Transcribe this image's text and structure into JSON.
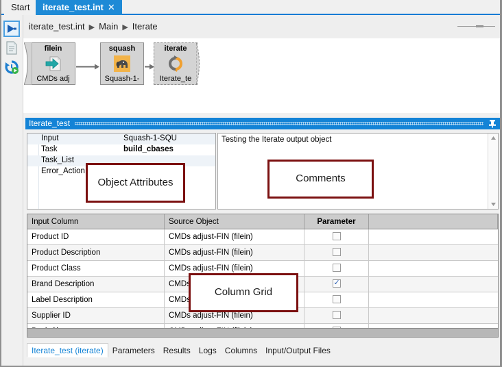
{
  "window": {
    "tabs": [
      {
        "label": "Start",
        "active": false,
        "closable": false
      },
      {
        "label": "iterate_test.int",
        "active": true,
        "closable": true,
        "close_glyph": "✕"
      }
    ]
  },
  "rail": {
    "icons": [
      {
        "name": "run-icon",
        "selected": true
      },
      {
        "name": "document-icon",
        "selected": false
      },
      {
        "name": "history-icon",
        "selected": false
      }
    ]
  },
  "breadcrumb": {
    "items": [
      "iterate_test.int",
      "Main",
      "Iterate"
    ],
    "separator": "▶"
  },
  "flow": {
    "nodes": [
      {
        "title": "filein",
        "subtitle": "CMDs adj",
        "icon": "file-in-icon"
      },
      {
        "title": "squash",
        "subtitle": "Squash-1-",
        "icon": "elephant-icon"
      },
      {
        "title": "iterate",
        "subtitle": "Iterate_te",
        "icon": "iterate-arrows-icon"
      }
    ]
  },
  "panel": {
    "title": "Iterate_test",
    "pin_glyph": "▬",
    "attributes": {
      "rows": [
        {
          "name": "Input",
          "value": "Squash-1-SQU",
          "bold": false
        },
        {
          "name": "Task",
          "value": "build_cbases",
          "bold": true
        },
        {
          "name": "Task_List",
          "value": "",
          "bold": false
        },
        {
          "name": "Error_Action",
          "value": "",
          "bold": false
        }
      ]
    },
    "comments": {
      "text": "Testing the Iterate output object",
      "scroll_up_glyph": "▲",
      "scroll_down_glyph": "▼"
    },
    "grid": {
      "headers": [
        "Input Column",
        "Source Object",
        "Parameter",
        ""
      ],
      "rows": [
        {
          "input_column": "Product ID",
          "source_object": "CMDs adjust-FIN (filein)",
          "parameter": false
        },
        {
          "input_column": "Product Description",
          "source_object": "CMDs adjust-FIN (filein)",
          "parameter": false
        },
        {
          "input_column": "Product Class",
          "source_object": "CMDs adjust-FIN (filein)",
          "parameter": false
        },
        {
          "input_column": "Brand Description",
          "source_object": "CMDs adjust-FIN (filein)",
          "parameter": true
        },
        {
          "input_column": "Label Description",
          "source_object": "CMDs adjust-FIN (filein)",
          "parameter": false
        },
        {
          "input_column": "Supplier ID",
          "source_object": "CMDs adjust-FIN (filein)",
          "parameter": false
        },
        {
          "input_column": "Pack Size",
          "source_object": "CMDs adjust-FIN (filein)",
          "parameter": false
        }
      ],
      "checked_glyph": "✓"
    },
    "bottom_tabs": [
      {
        "label": "Iterate_test (iterate)",
        "active": true
      },
      {
        "label": "Parameters",
        "active": false
      },
      {
        "label": "Results",
        "active": false
      },
      {
        "label": "Logs",
        "active": false
      },
      {
        "label": "Columns",
        "active": false
      },
      {
        "label": "Input/Output Files",
        "active": false
      }
    ]
  },
  "annotations": [
    {
      "id": "attrs",
      "label": "Object Attributes"
    },
    {
      "id": "comments",
      "label": "Comments"
    },
    {
      "id": "grid",
      "label": "Column Grid"
    }
  ],
  "colors": {
    "accent_blue": "#1383d6",
    "tab_blue": "#1e8ad6",
    "annotation_red": "#7b1010",
    "header_gray": "#cccccc",
    "node_gray": "#d4d4d4"
  }
}
